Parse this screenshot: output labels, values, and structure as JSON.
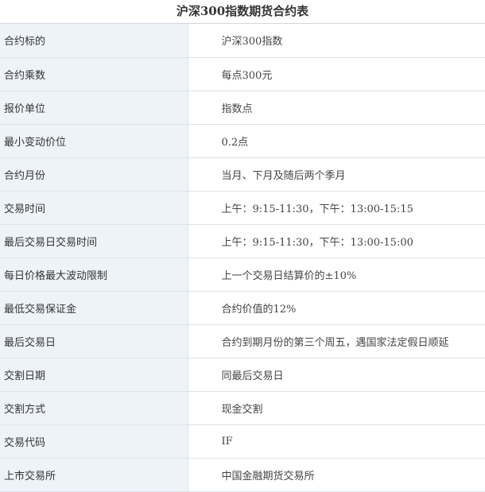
{
  "title": "沪深300指数期货合约表",
  "rows": [
    {
      "label": "合约标的",
      "value": "沪深300指数"
    },
    {
      "label": "合约乘数",
      "value": "每点300元"
    },
    {
      "label": "报价单位",
      "value": "指数点"
    },
    {
      "label": "最小变动价位",
      "value": "0.2点"
    },
    {
      "label": "合约月份",
      "value": "当月、下月及随后两个季月"
    },
    {
      "label": "交易时间",
      "value": "上午：9:15-11:30，下午：13:00-15:15"
    },
    {
      "label": "最后交易日交易时间",
      "value": "上午：9:15-11:30，下午：13:00-15:00"
    },
    {
      "label": "每日价格最大波动限制",
      "value": "上一个交易日结算价的±10%"
    },
    {
      "label": "最低交易保证金",
      "value": "合约价值的12%"
    },
    {
      "label": "最后交易日",
      "value": "合约到期月份的第三个周五，遇国家法定假日顺延"
    },
    {
      "label": "交割日期",
      "value": "同最后交易日"
    },
    {
      "label": "交割方式",
      "value": "现金交割"
    },
    {
      "label": "交易代码",
      "value": "IF"
    },
    {
      "label": "上市交易所",
      "value": "中国金融期货交易所"
    }
  ]
}
